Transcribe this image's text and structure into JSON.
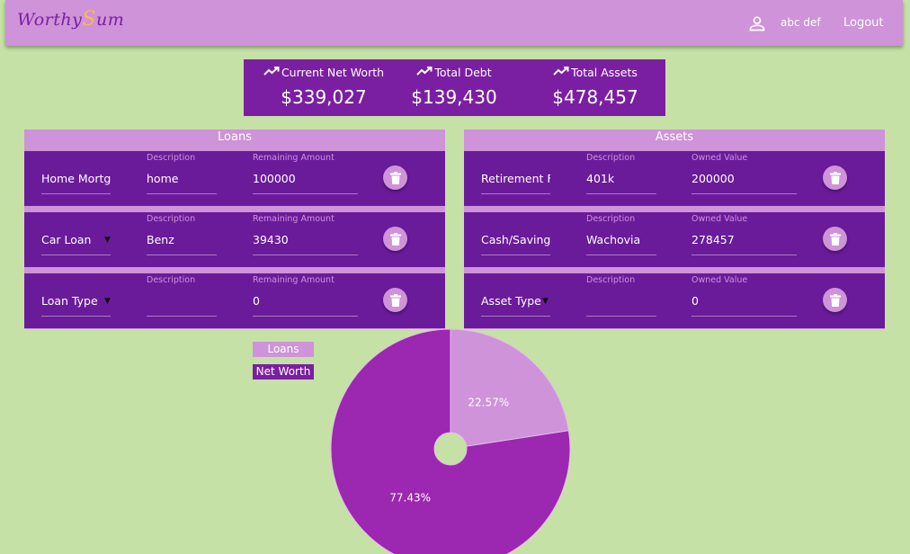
{
  "app": {
    "logo_prefix": "Worthy",
    "logo_s": "S",
    "logo_suffix": "um",
    "user_name": "abc def",
    "logout_label": "Logout"
  },
  "stats": [
    {
      "label": "Current Net Worth",
      "value": "$339,027",
      "icon": "trending-up-icon"
    },
    {
      "label": "Total Debt",
      "value": "$139,430",
      "icon": "trending-up-icon"
    },
    {
      "label": "Total Assets",
      "value": "$478,457",
      "icon": "trending-up-icon"
    }
  ],
  "loans": {
    "title": "Loans",
    "rows": [
      {
        "type": "Home Mortg",
        "description_label": "Description",
        "description": "home",
        "amount_label": "Remaining Amount",
        "amount": "100000",
        "has_caret": false
      },
      {
        "type": "Car Loan",
        "description_label": "Description",
        "description": "Benz",
        "amount_label": "Remaining Amount",
        "amount": "39430",
        "has_caret": true
      },
      {
        "type": "Loan Type",
        "description_label": "Description",
        "description": "",
        "amount_label": "Remaining Amount",
        "amount": "0",
        "has_caret": true
      }
    ]
  },
  "assets": {
    "title": "Assets",
    "rows": [
      {
        "type": "Retirement Fu",
        "description_label": "Description",
        "description": "401k",
        "amount_label": "Owned Value",
        "amount": "200000",
        "has_caret": false
      },
      {
        "type": "Cash/Saving",
        "description_label": "Description",
        "description": "Wachovia",
        "amount_label": "Owned Value",
        "amount": "278457",
        "has_caret": false
      },
      {
        "type": "Asset Type",
        "description_label": "Description",
        "description": "",
        "amount_label": "Owned Value",
        "amount": "0",
        "has_caret": true
      }
    ]
  },
  "colors": {
    "background": "#c5e1a5",
    "primary_dark": "#6a1b9a",
    "primary": "#7b1fa2",
    "primary_light": "#ce93d8",
    "pie_main": "#9c27b0",
    "accent": "#ffb74d"
  },
  "chart_data": {
    "type": "pie",
    "legend": [
      "Loans",
      "Net Worth"
    ],
    "legend_colors": [
      "#ce93d8",
      "#7b1fa2"
    ],
    "slices": [
      {
        "name": "Loans",
        "percent": 22.57,
        "label": "22.57%",
        "color": "#ce93d8"
      },
      {
        "name": "Net Worth",
        "percent": 77.43,
        "label": "77.43%",
        "color": "#9c27b0"
      }
    ],
    "donut_hole": true
  }
}
